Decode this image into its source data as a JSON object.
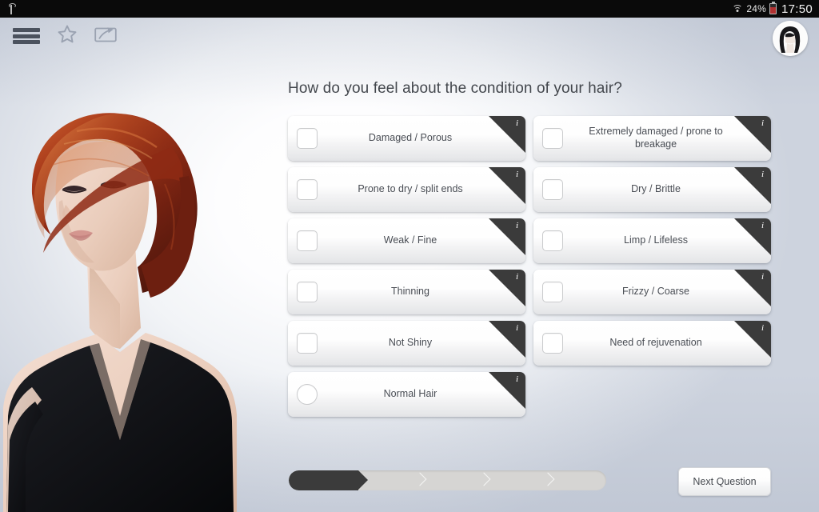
{
  "status_bar": {
    "usb_icon": "usb-icon",
    "wifi_icon": "wifi-icon",
    "battery_percent": "24%",
    "battery_icon": "battery-icon",
    "time": "17:50"
  },
  "toolbar": {
    "menu_icon": "hamburger-menu-icon",
    "favorite_icon": "star-icon",
    "share_icon": "share-icon",
    "avatar": "user-avatar"
  },
  "main": {
    "question": "How do you feel about the condition of your hair?",
    "options": [
      {
        "label": "Damaged / Porous",
        "control": "checkbox",
        "info": "i"
      },
      {
        "label": "Extremely damaged / prone to breakage",
        "control": "checkbox",
        "info": "i"
      },
      {
        "label": "Prone to dry / split ends",
        "control": "checkbox",
        "info": "i"
      },
      {
        "label": "Dry / Brittle",
        "control": "checkbox",
        "info": "i"
      },
      {
        "label": "Weak / Fine",
        "control": "checkbox",
        "info": "i"
      },
      {
        "label": "Limp / Lifeless",
        "control": "checkbox",
        "info": "i"
      },
      {
        "label": "Thinning",
        "control": "checkbox",
        "info": "i"
      },
      {
        "label": "Frizzy / Coarse",
        "control": "checkbox",
        "info": "i"
      },
      {
        "label": "Not Shiny",
        "control": "checkbox",
        "info": "i"
      },
      {
        "label": "Need of rejuvenation",
        "control": "checkbox",
        "info": "i"
      },
      {
        "label": "Normal Hair",
        "control": "radio",
        "info": "i"
      }
    ]
  },
  "footer": {
    "progress": {
      "steps": 5,
      "current_step": 1,
      "percent": 22
    },
    "next_label": "Next Question"
  },
  "colors": {
    "accent_dark": "#3b3b3b",
    "card_bg": "#ffffff",
    "text": "#4a4e55",
    "background": "#c3cad6",
    "progress_track": "#d6d5d3"
  }
}
